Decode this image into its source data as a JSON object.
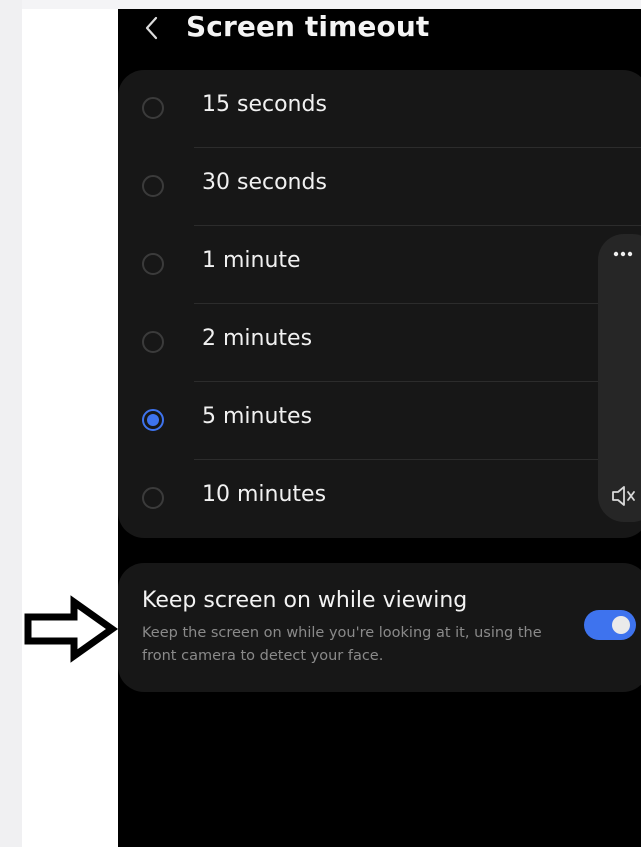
{
  "header": {
    "title": "Screen timeout"
  },
  "timeout_options": [
    {
      "label": "15 seconds",
      "selected": false
    },
    {
      "label": "30 seconds",
      "selected": false
    },
    {
      "label": "1 minute",
      "selected": false
    },
    {
      "label": "2 minutes",
      "selected": false
    },
    {
      "label": "5 minutes",
      "selected": true
    },
    {
      "label": "10 minutes",
      "selected": false
    }
  ],
  "keep_screen_on": {
    "title": "Keep screen on while viewing",
    "description": "Keep the screen on while you're looking at it, using the front camera to detect your face.",
    "enabled": true
  },
  "volume_panel": {
    "icons": [
      "more-options-icon",
      "sound-off-icon"
    ]
  },
  "colors": {
    "accent": "#3e73ee",
    "card": "#171717",
    "background": "#000000"
  }
}
